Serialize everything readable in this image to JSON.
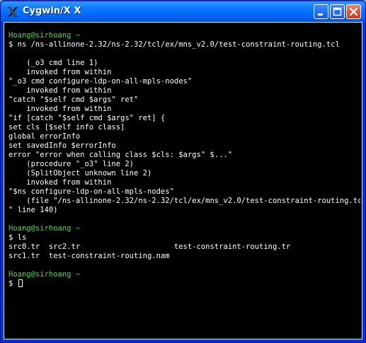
{
  "window": {
    "title": "Cygwin/X X",
    "icon": "x-logo-icon",
    "controls": {
      "minimize": "minimize-icon",
      "maximize": "maximize-icon",
      "close": "close-icon"
    },
    "colors": {
      "titlebar": "#0054e3",
      "close_button": "#e45b38",
      "terminal_bg": "#000000",
      "terminal_fg": "#ffffff",
      "prompt_fg": "#4fd64f"
    }
  },
  "terminal": {
    "lines": [
      {
        "type": "prompt",
        "text": "Hoang@sirhoang ~"
      },
      {
        "type": "output",
        "text": "$ ns /ns-allinone-2.32/ns-2.32/tcl/ex/mns_v2.0/test-constraint-routing.tcl"
      },
      {
        "type": "output",
        "text": ""
      },
      {
        "type": "output",
        "text": "    (_o3 cmd line 1)"
      },
      {
        "type": "output",
        "text": "    invoked from within"
      },
      {
        "type": "output",
        "text": "\"_o3 cmd configure-ldp-on-all-mpls-nodes\""
      },
      {
        "type": "output",
        "text": "    invoked from within"
      },
      {
        "type": "output",
        "text": "\"catch \"$self cmd $args\" ret\""
      },
      {
        "type": "output",
        "text": "    invoked from within"
      },
      {
        "type": "output",
        "text": "\"if [catch \"$self cmd $args\" ret] {"
      },
      {
        "type": "output",
        "text": "set cls [$self info class]"
      },
      {
        "type": "output",
        "text": "global errorInfo"
      },
      {
        "type": "output",
        "text": "set savedInfo $errorInfo"
      },
      {
        "type": "output",
        "text": "error \"error when calling class $cls: $args\" $...\""
      },
      {
        "type": "output",
        "text": "    (procedure \"_o3\" line 2)"
      },
      {
        "type": "output",
        "text": "    (SplitObject unknown line 2)"
      },
      {
        "type": "output",
        "text": "    invoked from within"
      },
      {
        "type": "output",
        "text": "\"$ns configure-ldp-on-all-mpls-nodes\""
      },
      {
        "type": "output",
        "text": "    (file \"/ns-allinone-2.32/ns-2.32/tcl/ex/mns_v2.0/test-constraint-routing.tcl"
      },
      {
        "type": "output",
        "text": "\" line 140)"
      },
      {
        "type": "output",
        "text": ""
      },
      {
        "type": "prompt",
        "text": "Hoang@sirhoang ~"
      },
      {
        "type": "output",
        "text": "$ ls"
      },
      {
        "type": "output",
        "text": "src0.tr  src2.tr                     test-constraint-routing.tr"
      },
      {
        "type": "output",
        "text": "src1.tr  test-constraint-routing.nam"
      },
      {
        "type": "output",
        "text": ""
      },
      {
        "type": "prompt",
        "text": "Hoang@sirhoang ~"
      },
      {
        "type": "output",
        "text": "$ "
      }
    ]
  }
}
